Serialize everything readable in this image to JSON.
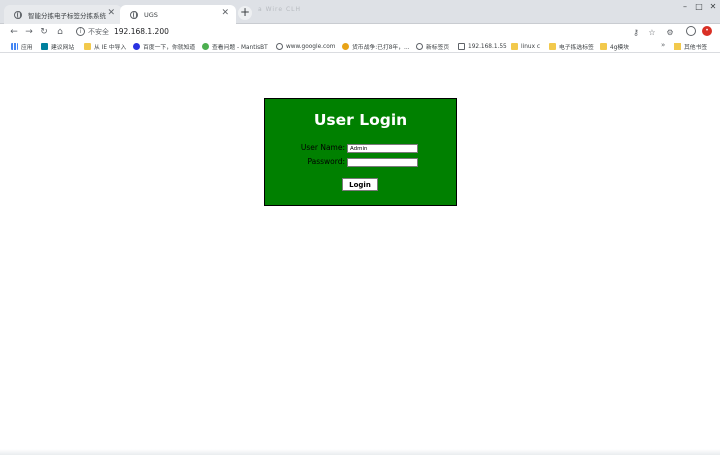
{
  "browser": {
    "tabs": [
      {
        "label": "智能分拣电子标签分拣系统",
        "active": false
      },
      {
        "label": "UGS",
        "active": true
      }
    ],
    "new_tab_symbol": "+",
    "ghost_tab_text": "a    Wire    CLH",
    "address": {
      "security_label": "不安全",
      "url": "192.168.1.200"
    },
    "nav_icons": [
      "back-arrow-icon",
      "forward-arrow-icon",
      "reload-icon",
      "home-icon"
    ],
    "toolbar_icons": [
      "key-icon",
      "star-icon",
      "extension-icon",
      "avatar-icon",
      "red-extension-icon"
    ]
  },
  "bookmarks": [
    {
      "label": "应用",
      "icon": "apps-grid-icon"
    },
    {
      "label": "建议网站",
      "icon": "bing-icon"
    },
    {
      "label": "从 IE 中导入",
      "icon": "folder-icon"
    },
    {
      "label": "百度一下，你就知道",
      "icon": "baidu-icon"
    },
    {
      "label": "查看问题 - MantisBT",
      "icon": "mantis-icon"
    },
    {
      "label": "www.google.com",
      "icon": "globe-icon"
    },
    {
      "label": "货币战争:已打8年，...",
      "icon": "coin-icon"
    },
    {
      "label": "新标签页",
      "icon": "globe-icon"
    },
    {
      "label": "192.168.1.55",
      "icon": "chart-icon"
    },
    {
      "label": "linux c",
      "icon": "folder-icon"
    },
    {
      "label": "电子拣选标签",
      "icon": "folder-icon"
    },
    {
      "label": "4g模块",
      "icon": "folder-icon"
    }
  ],
  "bookmarks_more": "»",
  "bookmarks_other": "其他书签",
  "login": {
    "title": "User Login",
    "username_label": "User Name:",
    "username_value": "Admin",
    "password_label": "Password:",
    "password_value": "",
    "button_label": "Login",
    "box_color": "#008000"
  }
}
